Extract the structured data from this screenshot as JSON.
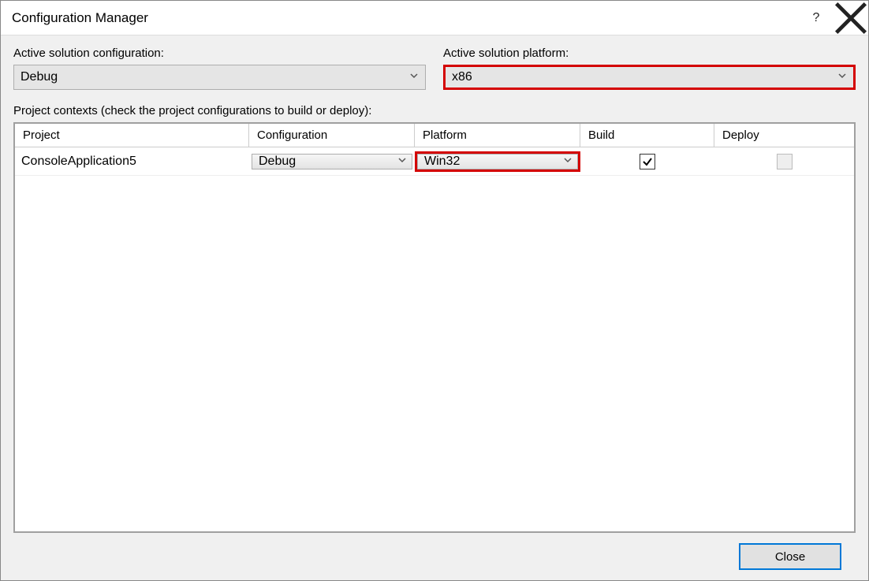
{
  "title": "Configuration Manager",
  "labels": {
    "active_config": "Active solution configuration:",
    "active_platform": "Active solution platform:",
    "contexts": "Project contexts (check the project configurations to build or deploy):"
  },
  "active_config_value": "Debug",
  "active_platform_value": "x86",
  "columns": {
    "project": "Project",
    "configuration": "Configuration",
    "platform": "Platform",
    "build": "Build",
    "deploy": "Deploy"
  },
  "rows": [
    {
      "project": "ConsoleApplication5",
      "configuration": "Debug",
      "platform": "Win32",
      "build": true,
      "deploy_enabled": false
    }
  ],
  "buttons": {
    "close": "Close"
  }
}
